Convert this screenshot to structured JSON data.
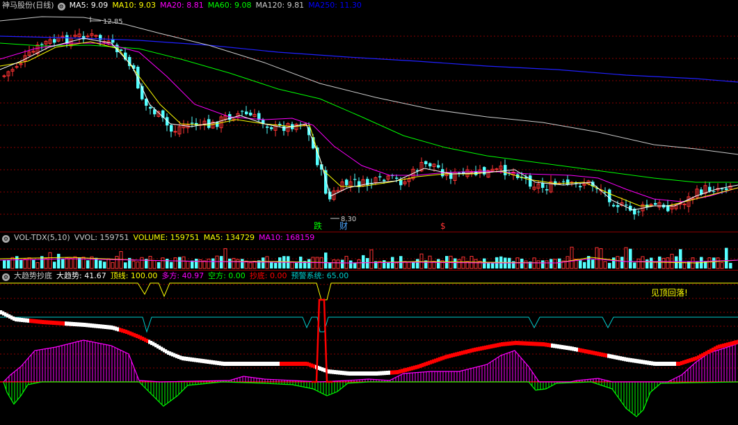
{
  "price_panel": {
    "stock_name": "神马股份(日线)",
    "ma_labels": [
      {
        "text": "MA5: 9.09",
        "color": "#ffffff"
      },
      {
        "text": "MA10: 9.03",
        "color": "#ffff00"
      },
      {
        "text": "MA20: 8.81",
        "color": "#ff00ff"
      },
      {
        "text": "MA60: 9.08",
        "color": "#00ff00"
      },
      {
        "text": "MA120: 9.81",
        "color": "#cccccc"
      },
      {
        "text": "MA250: 11.30",
        "color": "#0000ff"
      }
    ],
    "high_label": "12.85",
    "low_label": "8.30",
    "markers": [
      {
        "text": "跌",
        "color": "#00ff00"
      },
      {
        "text": "财",
        "color": "#4da6ff"
      },
      {
        "text": "$",
        "color": "#ff3333"
      }
    ]
  },
  "volume_panel": {
    "labels": [
      {
        "text": "VOL-TDX(5,10)",
        "color": "#cccccc"
      },
      {
        "text": "VVOL: 159751",
        "color": "#cccccc"
      },
      {
        "text": "VOLUME: 159751",
        "color": "#ffff00"
      },
      {
        "text": "MA5: 134729",
        "color": "#ffff00"
      },
      {
        "text": "MA10: 168159",
        "color": "#ff00ff"
      }
    ]
  },
  "indicator_panel": {
    "labels": [
      {
        "text": "大趋势抄底",
        "color": "#cccccc"
      },
      {
        "text": "大趋势: 41.67",
        "color": "#ffffff"
      },
      {
        "text": "顶线: 100.00",
        "color": "#ffff00"
      },
      {
        "text": "多方: 40.97",
        "color": "#ff00ff"
      },
      {
        "text": "空方: 0.00",
        "color": "#00ff00"
      },
      {
        "text": "抄底: 0.00",
        "color": "#ff0000"
      },
      {
        "text": "预警系统: 65.00",
        "color": "#00cccc"
      }
    ],
    "annotation": "见顶回落!"
  },
  "chart_data": {
    "type": "candlestick",
    "price_high": 12.85,
    "price_low": 8.3,
    "last_close": 9.09,
    "moving_averages": {
      "MA5": 9.09,
      "MA10": 9.03,
      "MA20": 8.81,
      "MA60": 9.08,
      "MA120": 9.81,
      "MA250": 11.3
    },
    "volume": {
      "VVOL": 159751,
      "VOLUME": 159751,
      "MA5": 134729,
      "MA10": 168159
    },
    "indicator": {
      "大趋势": 41.67,
      "顶线": 100.0,
      "多方": 40.97,
      "空方": 0.0,
      "抄底": 0.0,
      "预警系统": 65.0
    }
  }
}
